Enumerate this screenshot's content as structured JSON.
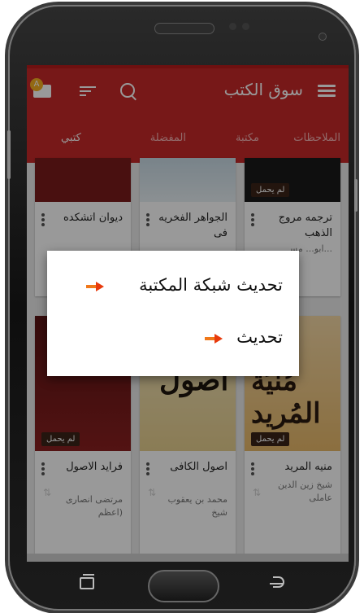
{
  "toolbar": {
    "title": "سوق الکتب",
    "badge": "A"
  },
  "tabs": [
    {
      "label": "الملاحظات"
    },
    {
      "label": "مكتبة"
    },
    {
      "label": "المفضلة"
    },
    {
      "label": "كتبي"
    }
  ],
  "books": [
    {
      "title": "ترجمه مروج الذهب",
      "author": "ابو... مسـ...",
      "cover_tag": "لم يحمل"
    },
    {
      "title": "الجواهر الفخريه فی",
      "author": "",
      "cover_tag": ""
    },
    {
      "title": "دیوان اتشکده",
      "author": "",
      "cover_tag": ""
    },
    {
      "title": "منیه المرید",
      "author": "شیخ زین الدین عاملی",
      "cover_tag": "لم يحمل",
      "cover_text": "مُنيَة المُريد"
    },
    {
      "title": "اصول الکافی",
      "author": "محمد بن یعقوب شیخ",
      "cover_tag": "",
      "cover_text": "اصول"
    },
    {
      "title": "فراید الاصول",
      "author": "مرتضی انصاری (اعظم",
      "cover_tag": "لم يحمل"
    }
  ],
  "dialog": {
    "items": [
      {
        "label": "تحديث شبكة المكتبة"
      },
      {
        "label": "تحديث"
      }
    ]
  },
  "colors": {
    "primary": "#c62828",
    "accent_arrow": "#f0781a"
  }
}
